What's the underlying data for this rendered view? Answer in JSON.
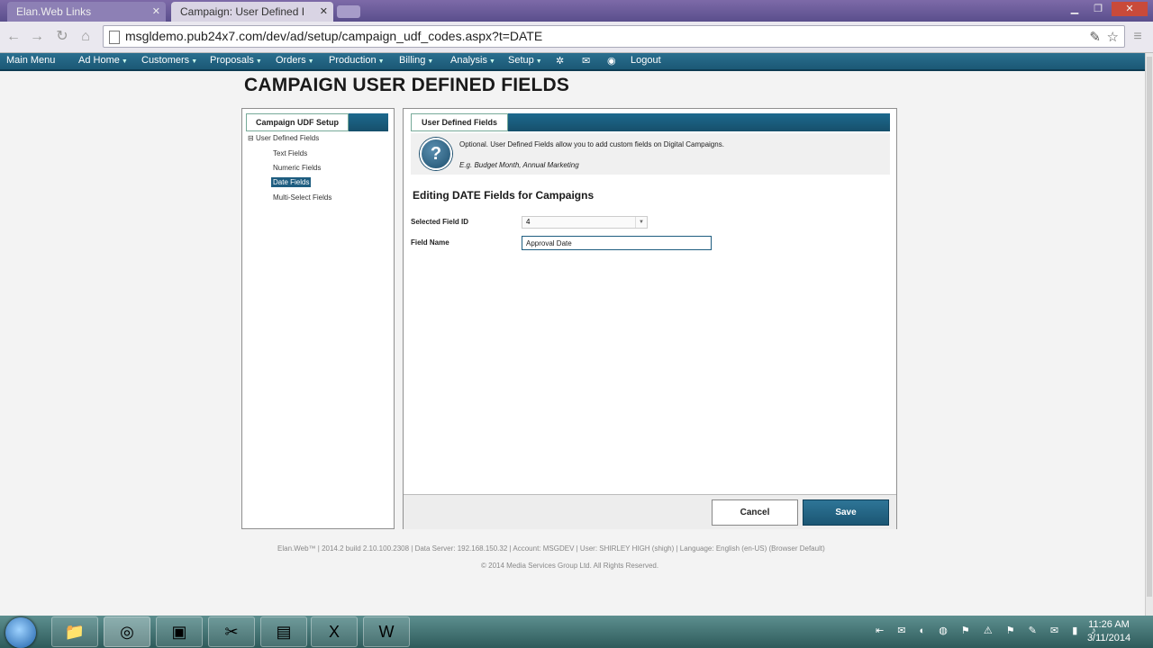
{
  "browser": {
    "tabs": [
      {
        "label": "Elan.Web Links"
      },
      {
        "label": "Campaign: User Defined I"
      }
    ],
    "url": "msgldemo.pub24x7.com/dev/ad/setup/campaign_udf_codes.aspx?t=DATE"
  },
  "menu": {
    "items": [
      "Main Menu",
      "Ad Home",
      "Customers",
      "Proposals",
      "Orders",
      "Production",
      "Billing",
      "Analysis",
      "Setup",
      "Logout"
    ]
  },
  "page": {
    "title": "CAMPAIGN USER DEFINED FIELDS"
  },
  "left_panel": {
    "tab_label": "Campaign UDF Setup",
    "tree_root": "User Defined Fields",
    "tree_items": [
      "Text Fields",
      "Numeric Fields",
      "Date Fields",
      "Multi-Select Fields"
    ],
    "selected": "Date Fields"
  },
  "right_panel": {
    "tab_label": "User Defined Fields",
    "info_line1": "Optional. User Defined Fields allow you to add custom fields on Digital Campaigns.",
    "info_line2": "E.g. Budget Month, Annual Marketing",
    "editing_title": "Editing DATE Fields for Campaigns",
    "selected_field_id_label": "Selected Field ID",
    "selected_field_id_value": "4",
    "field_name_label": "Field Name",
    "field_name_value": "Approval Date",
    "cancel_label": "Cancel",
    "save_label": "Save"
  },
  "footer": {
    "line1": "Elan.Web™  |  2014.2 build 2.10.100.2308  |  Data Server: 192.168.150.32  |  Account: MSGDEV  |  User: SHIRLEY HIGH (shigh)  |  Language: English (en-US) (Browser Default)",
    "line2": "© 2014 Media Services Group Ltd. All Rights Reserved."
  },
  "taskbar": {
    "time": "11:26 AM",
    "date": "3/11/2014"
  },
  "colors": {
    "menu_bar": "#1e6384",
    "panel_header": "#1d6a8e",
    "selected_tree": "#1e5d80",
    "save_button": "#2a6f8f"
  }
}
